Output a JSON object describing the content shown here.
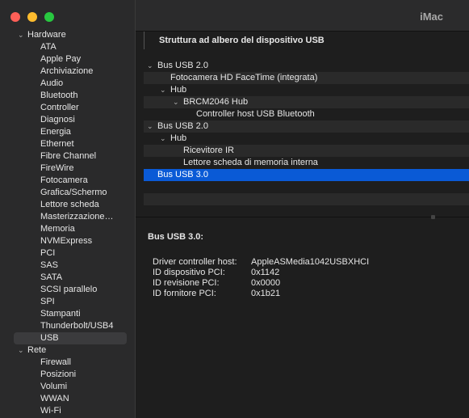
{
  "window": {
    "title": "iMac"
  },
  "sidebar": {
    "groups": [
      {
        "label": "Hardware",
        "items": [
          "ATA",
          "Apple Pay",
          "Archiviazione",
          "Audio",
          "Bluetooth",
          "Controller",
          "Diagnosi",
          "Energia",
          "Ethernet",
          "Fibre Channel",
          "FireWire",
          "Fotocamera",
          "Grafica/Schermo",
          "Lettore scheda",
          "Masterizzazione…",
          "Memoria",
          "NVMExpress",
          "PCI",
          "SAS",
          "SATA",
          "SCSI parallelo",
          "SPI",
          "Stampanti",
          "Thunderbolt/USB4",
          "USB"
        ]
      },
      {
        "label": "Rete",
        "items": [
          "Firewall",
          "Posizioni",
          "Volumi",
          "WWAN",
          "Wi-Fi"
        ]
      }
    ],
    "selected": "USB"
  },
  "usb_tree": {
    "header": "Struttura ad albero del dispositivo USB",
    "rows": [
      {
        "label": "Bus USB 2.0"
      },
      {
        "label": "Fotocamera HD FaceTime (integrata)"
      },
      {
        "label": "Hub"
      },
      {
        "label": "BRCM2046 Hub"
      },
      {
        "label": "Controller host USB Bluetooth"
      },
      {
        "label": "Bus USB 2.0"
      },
      {
        "label": "Hub"
      },
      {
        "label": "Ricevitore IR"
      },
      {
        "label": "Lettore scheda di memoria interna"
      },
      {
        "label": "Bus USB 3.0"
      }
    ],
    "selected": "Bus USB 3.0"
  },
  "detail": {
    "title": "Bus USB 3.0:",
    "properties": [
      {
        "label": "Driver controller host:",
        "value": "AppleASMedia1042USBXHCI"
      },
      {
        "label": "ID dispositivo PCI:",
        "value": "0x1142"
      },
      {
        "label": "ID revisione PCI:",
        "value": "0x0000"
      },
      {
        "label": "ID fornitore PCI:",
        "value": "0x1b21"
      }
    ]
  },
  "colors": {
    "selection": "#0a5ad6",
    "close": "#ff5f57",
    "minimize": "#febc2e",
    "zoom": "#28c840"
  },
  "icons": {
    "expanded": "chevron-down-icon"
  }
}
